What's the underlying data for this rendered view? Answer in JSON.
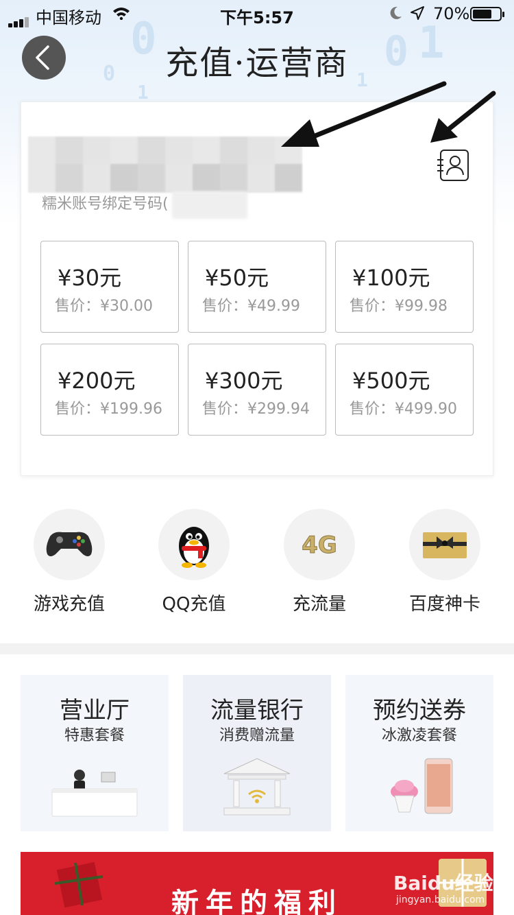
{
  "status_bar": {
    "carrier": "中国移动",
    "time": "下午5:57",
    "battery_text": "70%",
    "battery_level": 0.7
  },
  "header": {
    "title": "充值·运营商"
  },
  "recharge": {
    "bind_hint": "糯米账号绑定号码(",
    "options": [
      {
        "face": "¥30元",
        "sale": "售价：¥30.00"
      },
      {
        "face": "¥50元",
        "sale": "售价：¥49.99"
      },
      {
        "face": "¥100元",
        "sale": "售价：¥99.98"
      },
      {
        "face": "¥200元",
        "sale": "售价：¥199.96"
      },
      {
        "face": "¥300元",
        "sale": "售价：¥299.94"
      },
      {
        "face": "¥500元",
        "sale": "售价：¥499.90"
      }
    ]
  },
  "services": [
    {
      "label": "游戏充值",
      "icon": "gamepad-icon"
    },
    {
      "label": "QQ充值",
      "icon": "qq-penguin-icon"
    },
    {
      "label": "充流量",
      "icon": "4g-icon"
    },
    {
      "label": "百度神卡",
      "icon": "gift-card-icon"
    }
  ],
  "promos": [
    {
      "title": "营业厅",
      "subtitle": "特惠套餐",
      "bg": "#f3f6fa"
    },
    {
      "title": "流量银行",
      "subtitle": "消费赠流量",
      "bg": "#eef0f8"
    },
    {
      "title": "预约送券",
      "subtitle": "冰激凌套餐",
      "bg": "#f3f6fa"
    }
  ],
  "banner": {
    "text": "新年的福利",
    "watermark": "Baidu经验",
    "watermark_sub": "jingyan.baidu.com"
  },
  "colors": {
    "banner_red": "#d8202c",
    "border_gray": "#bbbbbb",
    "muted_text": "#999999"
  }
}
